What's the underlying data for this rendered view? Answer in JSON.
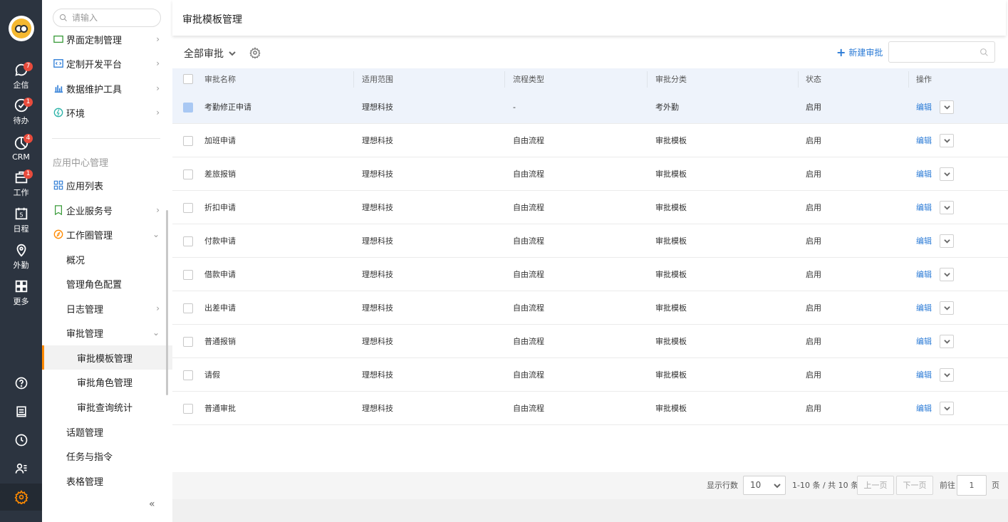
{
  "rail": {
    "items": [
      {
        "label": "企信",
        "icon": "chat-bubble-icon",
        "badge": "7"
      },
      {
        "label": "待办",
        "icon": "check-circle-icon",
        "badge": "1"
      },
      {
        "label": "CRM",
        "icon": "pie-chart-icon",
        "badge": "4"
      },
      {
        "label": "工作",
        "icon": "briefcase-icon",
        "badge": "1"
      },
      {
        "label": "日程",
        "icon": "calendar-icon",
        "day": "5"
      },
      {
        "label": "外勤",
        "icon": "location-pin-icon"
      },
      {
        "label": "更多",
        "icon": "grid-icon"
      }
    ],
    "bottom_icons": [
      "help-icon",
      "book-icon",
      "clock-icon",
      "user-list-icon",
      "settings-icon"
    ],
    "accent": "#ff8a00"
  },
  "sidebar": {
    "search_placeholder": "请输入",
    "items_top": [
      {
        "label": "界面定制管理"
      },
      {
        "label": "定制开发平台"
      },
      {
        "label": "数据维护工具"
      },
      {
        "label": "环境"
      }
    ],
    "group_title": "应用中心管理",
    "items": [
      {
        "label": "应用列表"
      },
      {
        "label": "企业服务号"
      },
      {
        "label": "工作圈管理"
      },
      {
        "label": "概况"
      },
      {
        "label": "管理角色配置"
      },
      {
        "label": "日志管理"
      },
      {
        "label": "审批管理"
      },
      {
        "label": "审批模板管理"
      },
      {
        "label": "审批角色管理"
      },
      {
        "label": "审批查询统计"
      },
      {
        "label": "话题管理"
      },
      {
        "label": "任务与指令"
      },
      {
        "label": "表格管理"
      }
    ],
    "collapse_glyph": "«"
  },
  "header": {
    "title": "审批模板管理"
  },
  "toolbar": {
    "filter_label": "全部审批",
    "new_label": "新建审批"
  },
  "table": {
    "columns": [
      "审批名称",
      "适用范围",
      "流程类型",
      "审批分类",
      "状态",
      "操作"
    ],
    "rows": [
      {
        "name": "考勤修正申请",
        "scope": "理想科技",
        "flow": "-",
        "category": "考外勤",
        "status": "启用",
        "action": "编辑"
      },
      {
        "name": "加班申请",
        "scope": "理想科技",
        "flow": "自由流程",
        "category": "审批模板",
        "status": "启用",
        "action": "编辑"
      },
      {
        "name": "差旅报销",
        "scope": "理想科技",
        "flow": "自由流程",
        "category": "审批模板",
        "status": "启用",
        "action": "编辑"
      },
      {
        "name": "折扣申请",
        "scope": "理想科技",
        "flow": "自由流程",
        "category": "审批模板",
        "status": "启用",
        "action": "编辑"
      },
      {
        "name": "付款申请",
        "scope": "理想科技",
        "flow": "自由流程",
        "category": "审批模板",
        "status": "启用",
        "action": "编辑"
      },
      {
        "name": "借款申请",
        "scope": "理想科技",
        "flow": "自由流程",
        "category": "审批模板",
        "status": "启用",
        "action": "编辑"
      },
      {
        "name": "出差申请",
        "scope": "理想科技",
        "flow": "自由流程",
        "category": "审批模板",
        "status": "启用",
        "action": "编辑"
      },
      {
        "name": "普通报销",
        "scope": "理想科技",
        "flow": "自由流程",
        "category": "审批模板",
        "status": "启用",
        "action": "编辑"
      },
      {
        "name": "请假",
        "scope": "理想科技",
        "flow": "自由流程",
        "category": "审批模板",
        "status": "启用",
        "action": "编辑"
      },
      {
        "name": "普通审批",
        "scope": "理想科技",
        "flow": "自由流程",
        "category": "审批模板",
        "status": "启用",
        "action": "编辑"
      }
    ]
  },
  "pagination": {
    "rows_label": "显示行数",
    "page_size": "10",
    "range_text": "1-10 条 / 共 10 条",
    "prev_label": "上一页",
    "next_label": "下一页",
    "goto_label": "前往",
    "page_input": "1",
    "page_unit": "页"
  },
  "colors": {
    "link": "#2b7bd6",
    "header_bg": "#eef3fb",
    "rail_bg": "#2c3440"
  }
}
